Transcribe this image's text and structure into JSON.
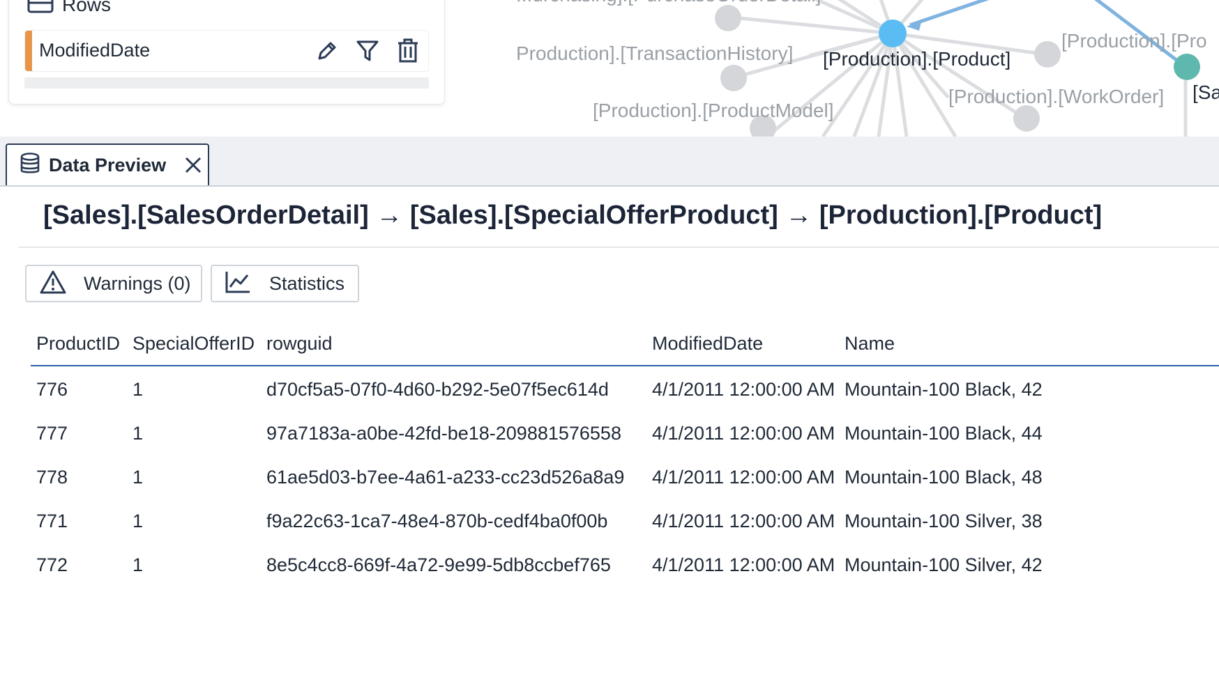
{
  "rows_panel": {
    "title": "Rows",
    "item": {
      "field": "ModifiedDate"
    }
  },
  "graph": {
    "labels": {
      "top": "...urchasing].[PurchaseOrderDetail]",
      "transaction_history": "Production].[TransactionHistory]",
      "product": "[Production].[Product]",
      "product_model": "[Production].[ProductModel]",
      "work_order": "[Production].[WorkOrder]",
      "right_1": "[Production].[Pro",
      "right_2": "[Sa"
    },
    "colors": {
      "focus_node": "#5bbcf3",
      "teal_node": "#5fb8ad",
      "gray_node": "#d4d6d9",
      "edge": "#dcdde0",
      "highlight_edge": "#7fb3e0"
    }
  },
  "tab": {
    "label": "Data Preview",
    "icon": "database-icon"
  },
  "path_title": "[Sales].[SalesOrderDetail] → [Sales].[SpecialOfferProduct] → [Production].[Product]",
  "buttons": {
    "warnings": "Warnings (0)",
    "statistics": "Statistics"
  },
  "table": {
    "columns": [
      "ProductID",
      "SpecialOfferID",
      "rowguid",
      "ModifiedDate",
      "Name"
    ],
    "rows": [
      [
        "776",
        "1",
        "d70cf5a5-07f0-4d60-b292-5e07f5ec614d",
        "4/1/2011 12:00:00 AM",
        "Mountain-100 Black, 42"
      ],
      [
        "777",
        "1",
        "97a7183a-a0be-42fd-be18-209881576558",
        "4/1/2011 12:00:00 AM",
        "Mountain-100 Black, 44"
      ],
      [
        "778",
        "1",
        "61ae5d03-b7ee-4a61-a233-cc23d526a8a9",
        "4/1/2011 12:00:00 AM",
        "Mountain-100 Black, 48"
      ],
      [
        "771",
        "1",
        "f9a22c63-1ca7-48e4-870b-cedf4ba0f00b",
        "4/1/2011 12:00:00 AM",
        "Mountain-100 Silver, 38"
      ],
      [
        "772",
        "1",
        "8e5c4cc8-669f-4a72-9e99-5db8ccbef765",
        "4/1/2011 12:00:00 AM",
        "Mountain-100 Silver, 42"
      ]
    ]
  }
}
